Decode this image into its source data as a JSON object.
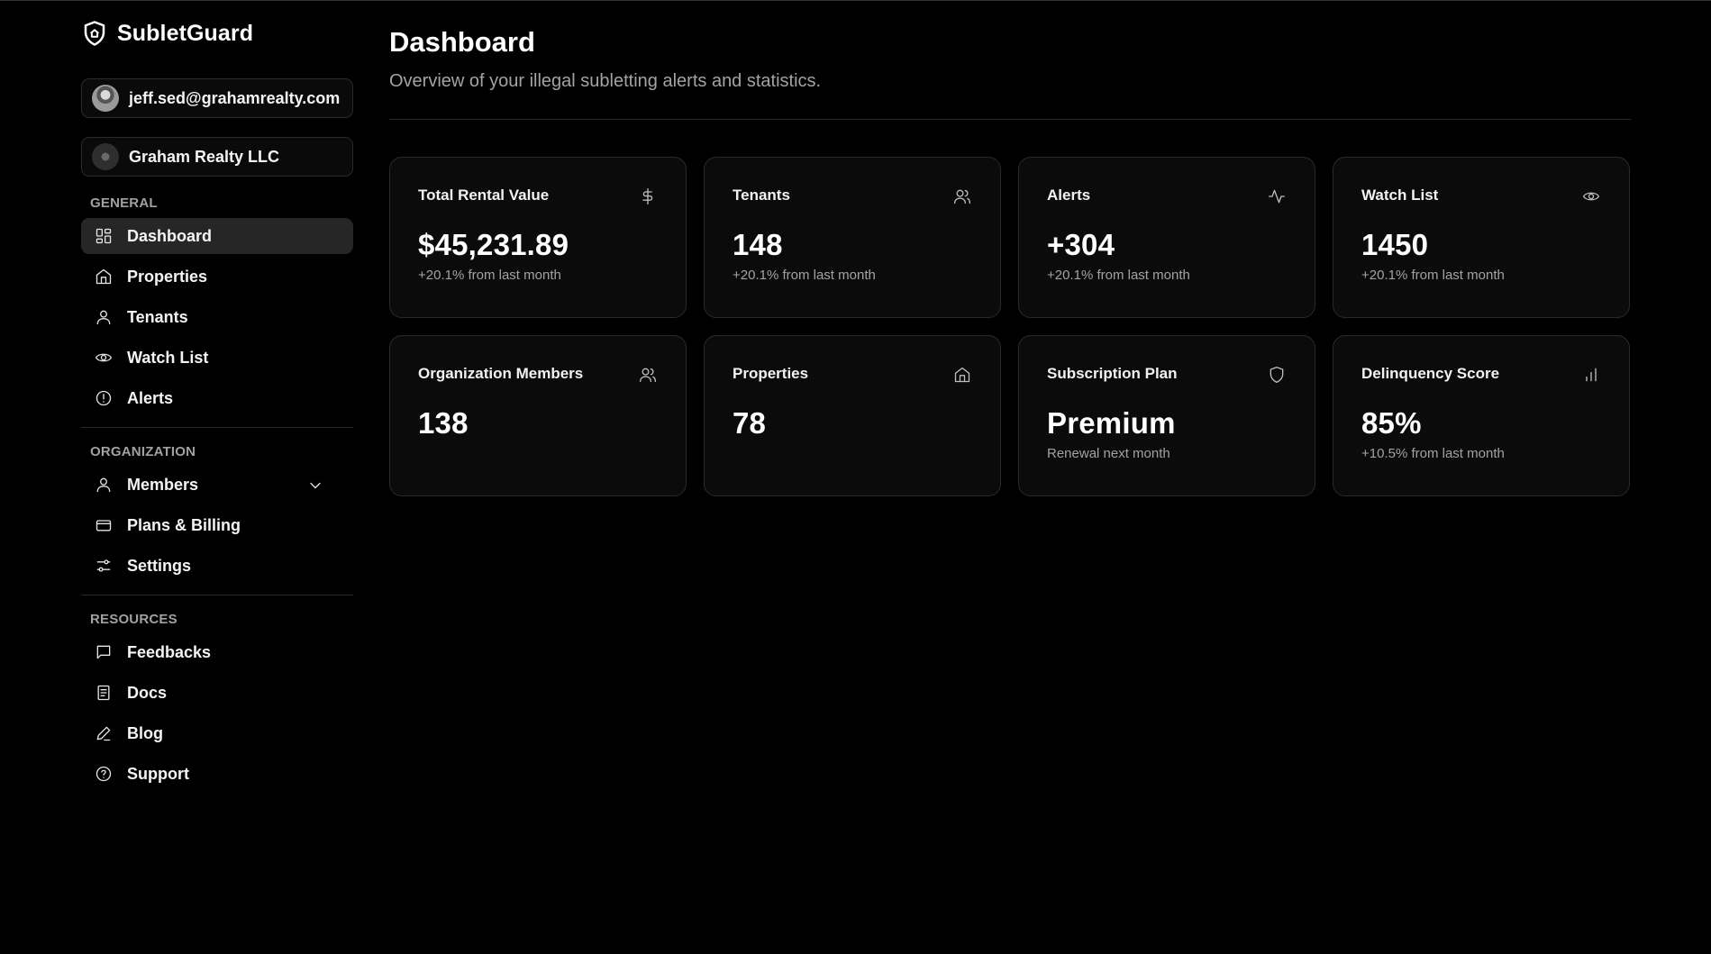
{
  "app": {
    "brand_name": "SubletGuard"
  },
  "sidebar": {
    "user_email": "jeff.sed@grahamrealty.com",
    "organization": "Graham Realty LLC",
    "sections": {
      "general": {
        "title": "GENERAL",
        "items": [
          {
            "label": "Dashboard",
            "icon": "dashboard-icon"
          },
          {
            "label": "Properties",
            "icon": "home-icon"
          },
          {
            "label": "Tenants",
            "icon": "user-icon"
          },
          {
            "label": "Watch List",
            "icon": "eye-icon"
          },
          {
            "label": "Alerts",
            "icon": "alert-circle-icon"
          }
        ]
      },
      "organization": {
        "title": "ORGANIZATION",
        "items": [
          {
            "label": "Members",
            "icon": "user-icon"
          },
          {
            "label": "Plans & Billing",
            "icon": "credit-card-icon"
          },
          {
            "label": "Settings",
            "icon": "sliders-icon"
          }
        ]
      },
      "resources": {
        "title": "RESOURCES",
        "items": [
          {
            "label": "Feedbacks",
            "icon": "message-square-icon"
          },
          {
            "label": "Docs",
            "icon": "document-icon"
          },
          {
            "label": "Blog",
            "icon": "pencil-icon"
          },
          {
            "label": "Support",
            "icon": "help-circle-icon"
          }
        ]
      }
    }
  },
  "main": {
    "title": "Dashboard",
    "subtitle": "Overview of your illegal subletting alerts and statistics.",
    "cards": [
      {
        "title": "Total Rental Value",
        "value": "$45,231.89",
        "note": "+20.1% from last month",
        "icon": "dollar-icon"
      },
      {
        "title": "Tenants",
        "value": "148",
        "note": "+20.1% from last month",
        "icon": "users-icon"
      },
      {
        "title": "Alerts",
        "value": "+304",
        "note": "+20.1% from last month",
        "icon": "activity-icon"
      },
      {
        "title": "Watch List",
        "value": "1450",
        "note": "+20.1% from last month",
        "icon": "eye-icon"
      },
      {
        "title": "Organization Members",
        "value": "138",
        "note": "",
        "icon": "users-icon"
      },
      {
        "title": "Properties",
        "value": "78",
        "note": "",
        "icon": "home-icon"
      },
      {
        "title": "Subscription Plan",
        "value": "Premium",
        "note": "Renewal next month",
        "icon": "shield-icon"
      },
      {
        "title": "Delinquency Score",
        "value": "85%",
        "note": "+10.5% from last month",
        "icon": "bar-chart-icon"
      }
    ]
  }
}
